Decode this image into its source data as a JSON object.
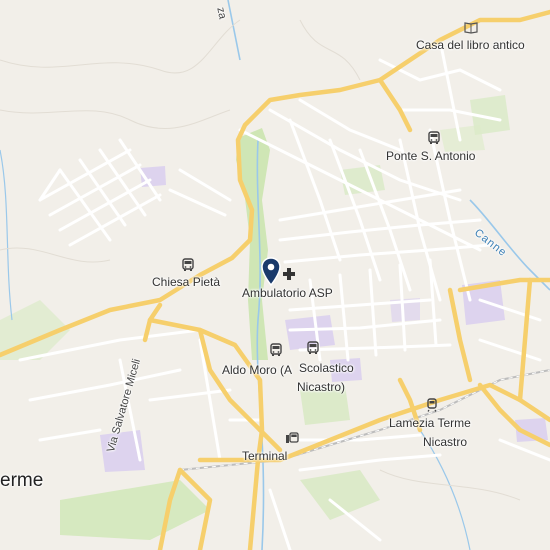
{
  "places": {
    "casa_libro": "Casa del libro antico",
    "ponte": "Ponte S. Antonio",
    "chiesa": "Chiesa Pietà",
    "ambulatorio": "Ambulatorio ASP",
    "aldo_moro": "Aldo Moro (A",
    "scolastico_1": "Scolastico",
    "scolastico_2": "Nicastro)",
    "lamezia_1": "Lamezia Terme",
    "lamezia_2": "Nicastro",
    "terminal": "Terminal",
    "terme": "erme"
  },
  "streets": {
    "miceli": "Via Salvatore Miceli",
    "top_road": "za"
  },
  "water": {
    "canne": "Canne"
  },
  "icons": {
    "bus": "bus-stop-icon",
    "train": "train-station-icon",
    "book": "bookshop-icon",
    "medical": "medical-cross-icon",
    "pin": "location-pin-icon"
  },
  "colors": {
    "background": "#f2efe9",
    "major_road": "#f6cf6c",
    "minor_road": "#ffffff",
    "park": "#cfe6b5",
    "school": "#ddd3ee",
    "water": "#9ac8ea",
    "pin": "#1a3a6b"
  }
}
